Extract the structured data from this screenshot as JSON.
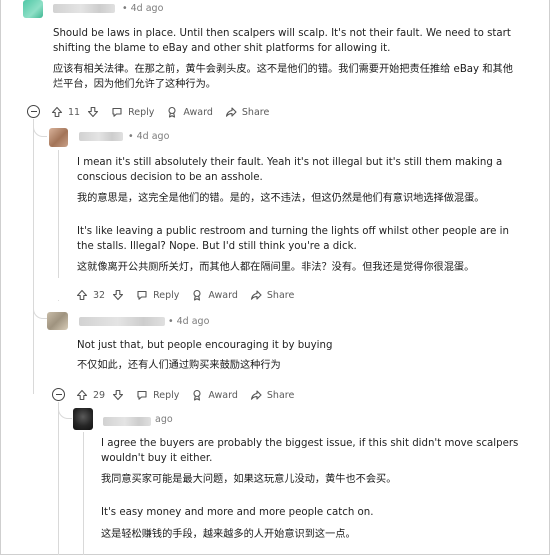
{
  "comments": [
    {
      "meta": "• 4d ago",
      "en": "Should be laws in place. Until then scalpers will scalp. It's not their fault. We need to start shifting the blame to eBay and other shit platforms for allowing it.",
      "zh": "应该有相关法律。在那之前，黄牛会剥头皮。这不是他们的错。我们需要开始把责任推给 eBay 和其他烂平台，因为他们允许了这种行为。",
      "votes": "11",
      "reply": "Reply",
      "award": "Award",
      "share": "Share"
    },
    {
      "meta": "• 4d ago",
      "en1": "I mean it's still absolutely their fault. Yeah it's not illegal but it's still them making a conscious decision to be an asshole.",
      "zh1": "我的意思是，这完全是他们的错。是的，这不违法，但这仍然是他们有意识地选择做混蛋。",
      "en2": "It's like leaving a public restroom and turning the lights off whilst other people are in the stalls. Illegal? Nope. But I'd still think you're a dick.",
      "zh2": "这就像离开公共厕所关灯，而其他人都在隔间里。非法？没有。但我还是觉得你很混蛋。",
      "votes": "32",
      "reply": "Reply",
      "award": "Award",
      "share": "Share"
    },
    {
      "meta": "• 4d ago",
      "en": "Not just that, but people encouraging it by buying",
      "zh": "不仅如此，还有人们通过购买来鼓励这种行为",
      "votes": "29",
      "reply": "Reply",
      "award": "Award",
      "share": "Share"
    },
    {
      "meta": "ago",
      "en1": "I agree the buyers are probably the biggest issue, if this shit didn't move scalpers wouldn't buy it either.",
      "zh1": "我同意买家可能是最大问题，如果这玩意儿没动，黄牛也不会买。",
      "en2": "It's easy money and more and more people catch on.",
      "zh2": "这是轻松赚钱的手段，越来越多的人开始意识到这一点。"
    }
  ],
  "colors": {
    "avatar1": "#59c9a5",
    "avatar2": "#c69a7e",
    "avatar3": "#b9ad98",
    "avatar4": "#2b2b2b",
    "thread_line": "#d9d9d9"
  },
  "icons": [
    "upvote-icon",
    "downvote-icon",
    "reply-icon",
    "award-icon",
    "share-icon",
    "collapse-icon"
  ]
}
